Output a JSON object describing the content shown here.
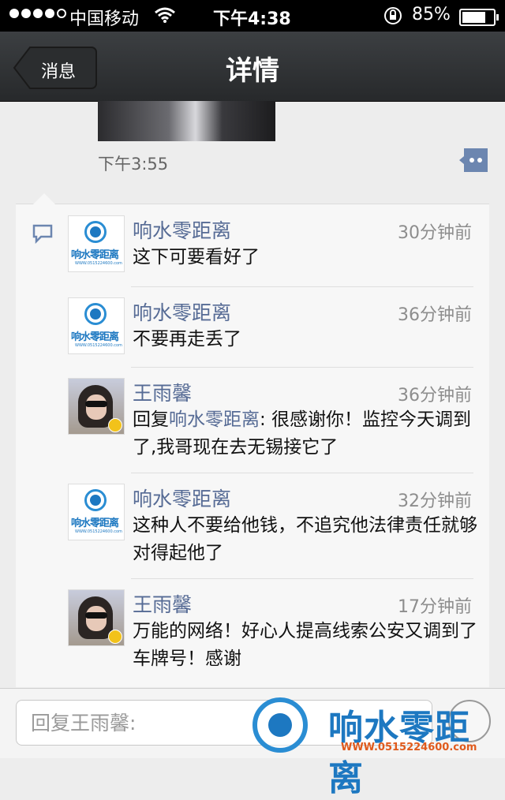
{
  "status_bar": {
    "carrier": "中国移动",
    "time": "下午4:38",
    "battery": "85%",
    "battery_level": 0.85
  },
  "nav": {
    "back_label": "消息",
    "title": "详情"
  },
  "post": {
    "time": "下午3:55"
  },
  "comments": [
    {
      "author": "响水零距离",
      "time_ago": "30分钟前",
      "text": "这下可要看好了",
      "avatar": "logo-avatar"
    },
    {
      "author": "响水零距离",
      "time_ago": "36分钟前",
      "text": "不要再走丢了",
      "avatar": "logo-avatar"
    },
    {
      "author": "王雨馨",
      "time_ago": "36分钟前",
      "reply_prefix": "回复",
      "reply_to": "响水零距离",
      "text": ": 很感谢你！监控今天调到了,我哥现在去无锡接它了",
      "avatar": "user-avatar"
    },
    {
      "author": "响水零距离",
      "time_ago": "32分钟前",
      "text": "这种人不要给他钱，不追究他法律责任就够对得起他了",
      "avatar": "logo-avatar"
    },
    {
      "author": "王雨馨",
      "time_ago": "17分钟前",
      "text": "万能的网络！好心人提高线索公安又调到了车牌号！感谢",
      "avatar": "user-avatar"
    }
  ],
  "avatar_logo": {
    "text": "响水零距离",
    "url": "WWW.0515224600.com"
  },
  "reply": {
    "placeholder": "回复王雨馨:"
  },
  "watermark": {
    "text": "响水零距离",
    "url": "WWW.0515224600.com"
  }
}
